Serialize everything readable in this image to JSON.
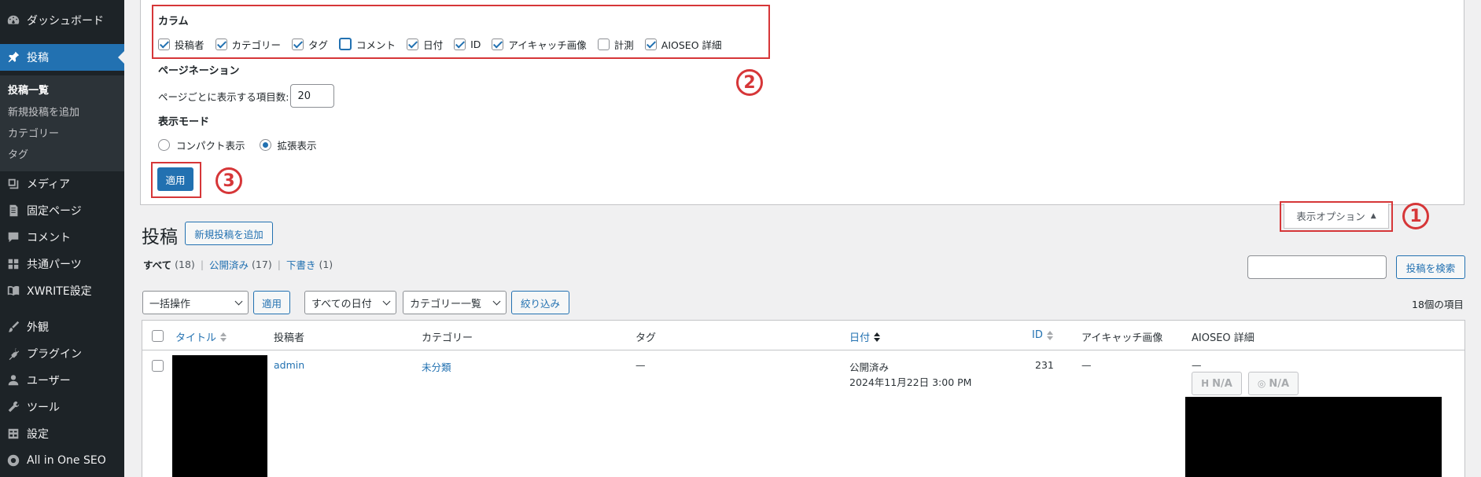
{
  "sidebar": {
    "items": [
      {
        "key": "dashboard",
        "label": "ダッシュボード",
        "icon": "dashboard-icon"
      },
      {
        "key": "posts",
        "label": "投稿",
        "icon": "pin-icon",
        "active": true
      },
      {
        "key": "media",
        "label": "メディア",
        "icon": "media-icon"
      },
      {
        "key": "pages",
        "label": "固定ページ",
        "icon": "page-icon"
      },
      {
        "key": "comments",
        "label": "コメント",
        "icon": "comment-icon"
      },
      {
        "key": "parts",
        "label": "共通パーツ",
        "icon": "grid-icon"
      },
      {
        "key": "xwrite",
        "label": "XWRITE設定",
        "icon": "book-icon"
      },
      {
        "key": "appearance",
        "label": "外観",
        "icon": "brush-icon"
      },
      {
        "key": "plugins",
        "label": "プラグイン",
        "icon": "plugin-icon"
      },
      {
        "key": "users",
        "label": "ユーザー",
        "icon": "user-icon"
      },
      {
        "key": "tools",
        "label": "ツール",
        "icon": "wrench-icon"
      },
      {
        "key": "settings",
        "label": "設定",
        "icon": "settings-icon"
      },
      {
        "key": "aioseo",
        "label": "All in One SEO",
        "icon": "aioseo-icon"
      }
    ],
    "submenu": [
      {
        "label": "投稿一覧",
        "current": true
      },
      {
        "label": "新規投稿を追加"
      },
      {
        "label": "カテゴリー"
      },
      {
        "label": "タグ"
      }
    ]
  },
  "screen_options": {
    "columns_heading": "カラム",
    "columns": [
      {
        "label": "投稿者",
        "checked": true
      },
      {
        "label": "カテゴリー",
        "checked": true
      },
      {
        "label": "タグ",
        "checked": true
      },
      {
        "label": "コメント",
        "checked": false,
        "focused": true
      },
      {
        "label": "日付",
        "checked": true
      },
      {
        "label": "ID",
        "checked": true
      },
      {
        "label": "アイキャッチ画像",
        "checked": true
      },
      {
        "label": "計測",
        "checked": false
      },
      {
        "label": "AIOSEO 詳細",
        "checked": true
      }
    ],
    "pagination_heading": "ページネーション",
    "per_page_label": "ページごとに表示する項目数:",
    "per_page_value": "20",
    "view_mode_heading": "表示モード",
    "view_modes": [
      {
        "label": "コンパクト表示",
        "checked": false
      },
      {
        "label": "拡張表示",
        "checked": true
      }
    ],
    "apply_label": "適用",
    "tab_label": "表示オプション",
    "tab_arrow": "▲"
  },
  "annotations": {
    "n1": "1",
    "n2": "2",
    "n3": "3",
    "accent": "#d63638"
  },
  "posts": {
    "title": "投稿",
    "add_new_label": "新規投稿を追加",
    "filters": [
      {
        "label": "すべて",
        "count": "(18)",
        "current": true
      },
      {
        "label": "公開済み",
        "count": "(17)"
      },
      {
        "label": "下書き",
        "count": "(1)"
      }
    ],
    "filter_sep": "|",
    "search_button": "投稿を検索",
    "bulk_action": "一括操作",
    "bulk_apply": "適用",
    "date_filter": "すべての日付",
    "category_filter": "カテゴリー一覧",
    "filter_button": "絞り込み",
    "items_count": "18個の項目",
    "columns": {
      "title": "タイトル",
      "author": "投稿者",
      "categories": "カテゴリー",
      "tags": "タグ",
      "date": "日付",
      "id": "ID",
      "featured": "アイキャッチ画像",
      "aioseo": "AIOSEO 詳細"
    },
    "rows": [
      {
        "author": "admin",
        "category": "未分類",
        "tags": "—",
        "date_status": "公開済み",
        "date": "2024年11月22日 3:00 PM",
        "id": "231",
        "featured": "—",
        "aioseo": "—",
        "badge1": "N/A",
        "badge2": "N/A"
      }
    ]
  },
  "colors": {
    "sidebar_bg": "#1d2327",
    "primary": "#2271b1",
    "page_bg": "#f0f0f1"
  }
}
